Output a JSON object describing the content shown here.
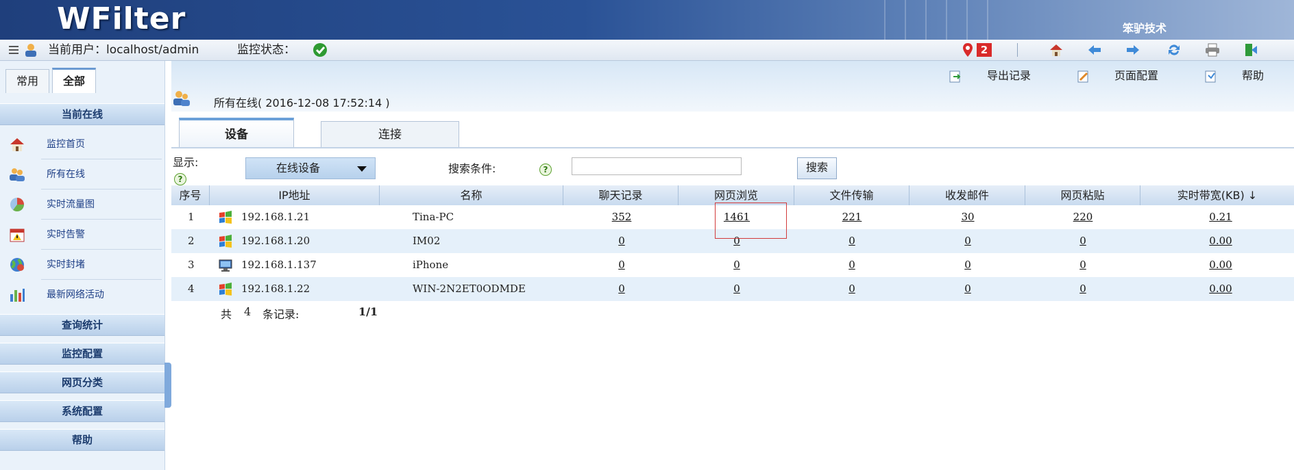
{
  "banner": {
    "logo": "WFilter",
    "brand": "笨驴技术"
  },
  "statusbar": {
    "user_label": "当前用户：localhost/admin",
    "monitor_label": "监控状态：",
    "alert_count": "2"
  },
  "sidebar": {
    "tabs": [
      {
        "label": "常用"
      },
      {
        "label": "全部"
      }
    ],
    "sections": {
      "current_online": "当前在线",
      "query_stats": "查询统计",
      "monitor_config": "监控配置",
      "web_category": "网页分类",
      "system_config": "系统配置",
      "help": "帮助"
    },
    "items": [
      {
        "label": "监控首页",
        "icon": "home-icon"
      },
      {
        "label": "所有在线",
        "icon": "users-icon"
      },
      {
        "label": "实时流量图",
        "icon": "pie-chart-icon"
      },
      {
        "label": "实时告警",
        "icon": "calendar-alert-icon"
      },
      {
        "label": "实时封堵",
        "icon": "globe-block-icon"
      },
      {
        "label": "最新网络活动",
        "icon": "bar-chart-icon"
      }
    ]
  },
  "main": {
    "actions": {
      "export": "导出记录",
      "page_config": "页面配置",
      "help": "帮助"
    },
    "crumb": "所有在线(   2016-12-08 17:52:14 )",
    "tabs": [
      {
        "label": "设备"
      },
      {
        "label": "连接"
      }
    ],
    "filter": {
      "show_label": "显示:",
      "show_value": "在线设备",
      "search_label": "搜索条件:",
      "search_value": "",
      "search_button": "搜索"
    },
    "table": {
      "columns": [
        "序号",
        "IP地址",
        "名称",
        "聊天记录",
        "网页浏览",
        "文件传输",
        "收发邮件",
        "网页粘贴",
        "实时带宽(KB) ↓"
      ],
      "rows": [
        {
          "index": "1",
          "os": "windows-icon",
          "ip": "192.168.1.21",
          "name": "Tina-PC",
          "chat": "352",
          "web": "1461",
          "file": "221",
          "mail": "30",
          "paste": "220",
          "bw": "0.21"
        },
        {
          "index": "2",
          "os": "windows-icon",
          "ip": "192.168.1.20",
          "name": "IM02",
          "chat": "0",
          "web": "0",
          "file": "0",
          "mail": "0",
          "paste": "0",
          "bw": "0.00"
        },
        {
          "index": "3",
          "os": "monitor-icon",
          "ip": "192.168.1.137",
          "name": "iPhone",
          "chat": "0",
          "web": "0",
          "file": "0",
          "mail": "0",
          "paste": "0",
          "bw": "0.00"
        },
        {
          "index": "4",
          "os": "windows-icon",
          "ip": "192.168.1.22",
          "name": "WIN-2N2ET0ODMDE",
          "chat": "0",
          "web": "0",
          "file": "0",
          "mail": "0",
          "paste": "0",
          "bw": "0.00"
        }
      ]
    },
    "footer": {
      "total_prefix": "共",
      "total": "4",
      "total_suffix": "条记录:",
      "page": "1/1"
    }
  },
  "colors": {
    "accent": "#6ba0d8",
    "alert": "#d92a2a",
    "ok": "#2e9a32"
  }
}
